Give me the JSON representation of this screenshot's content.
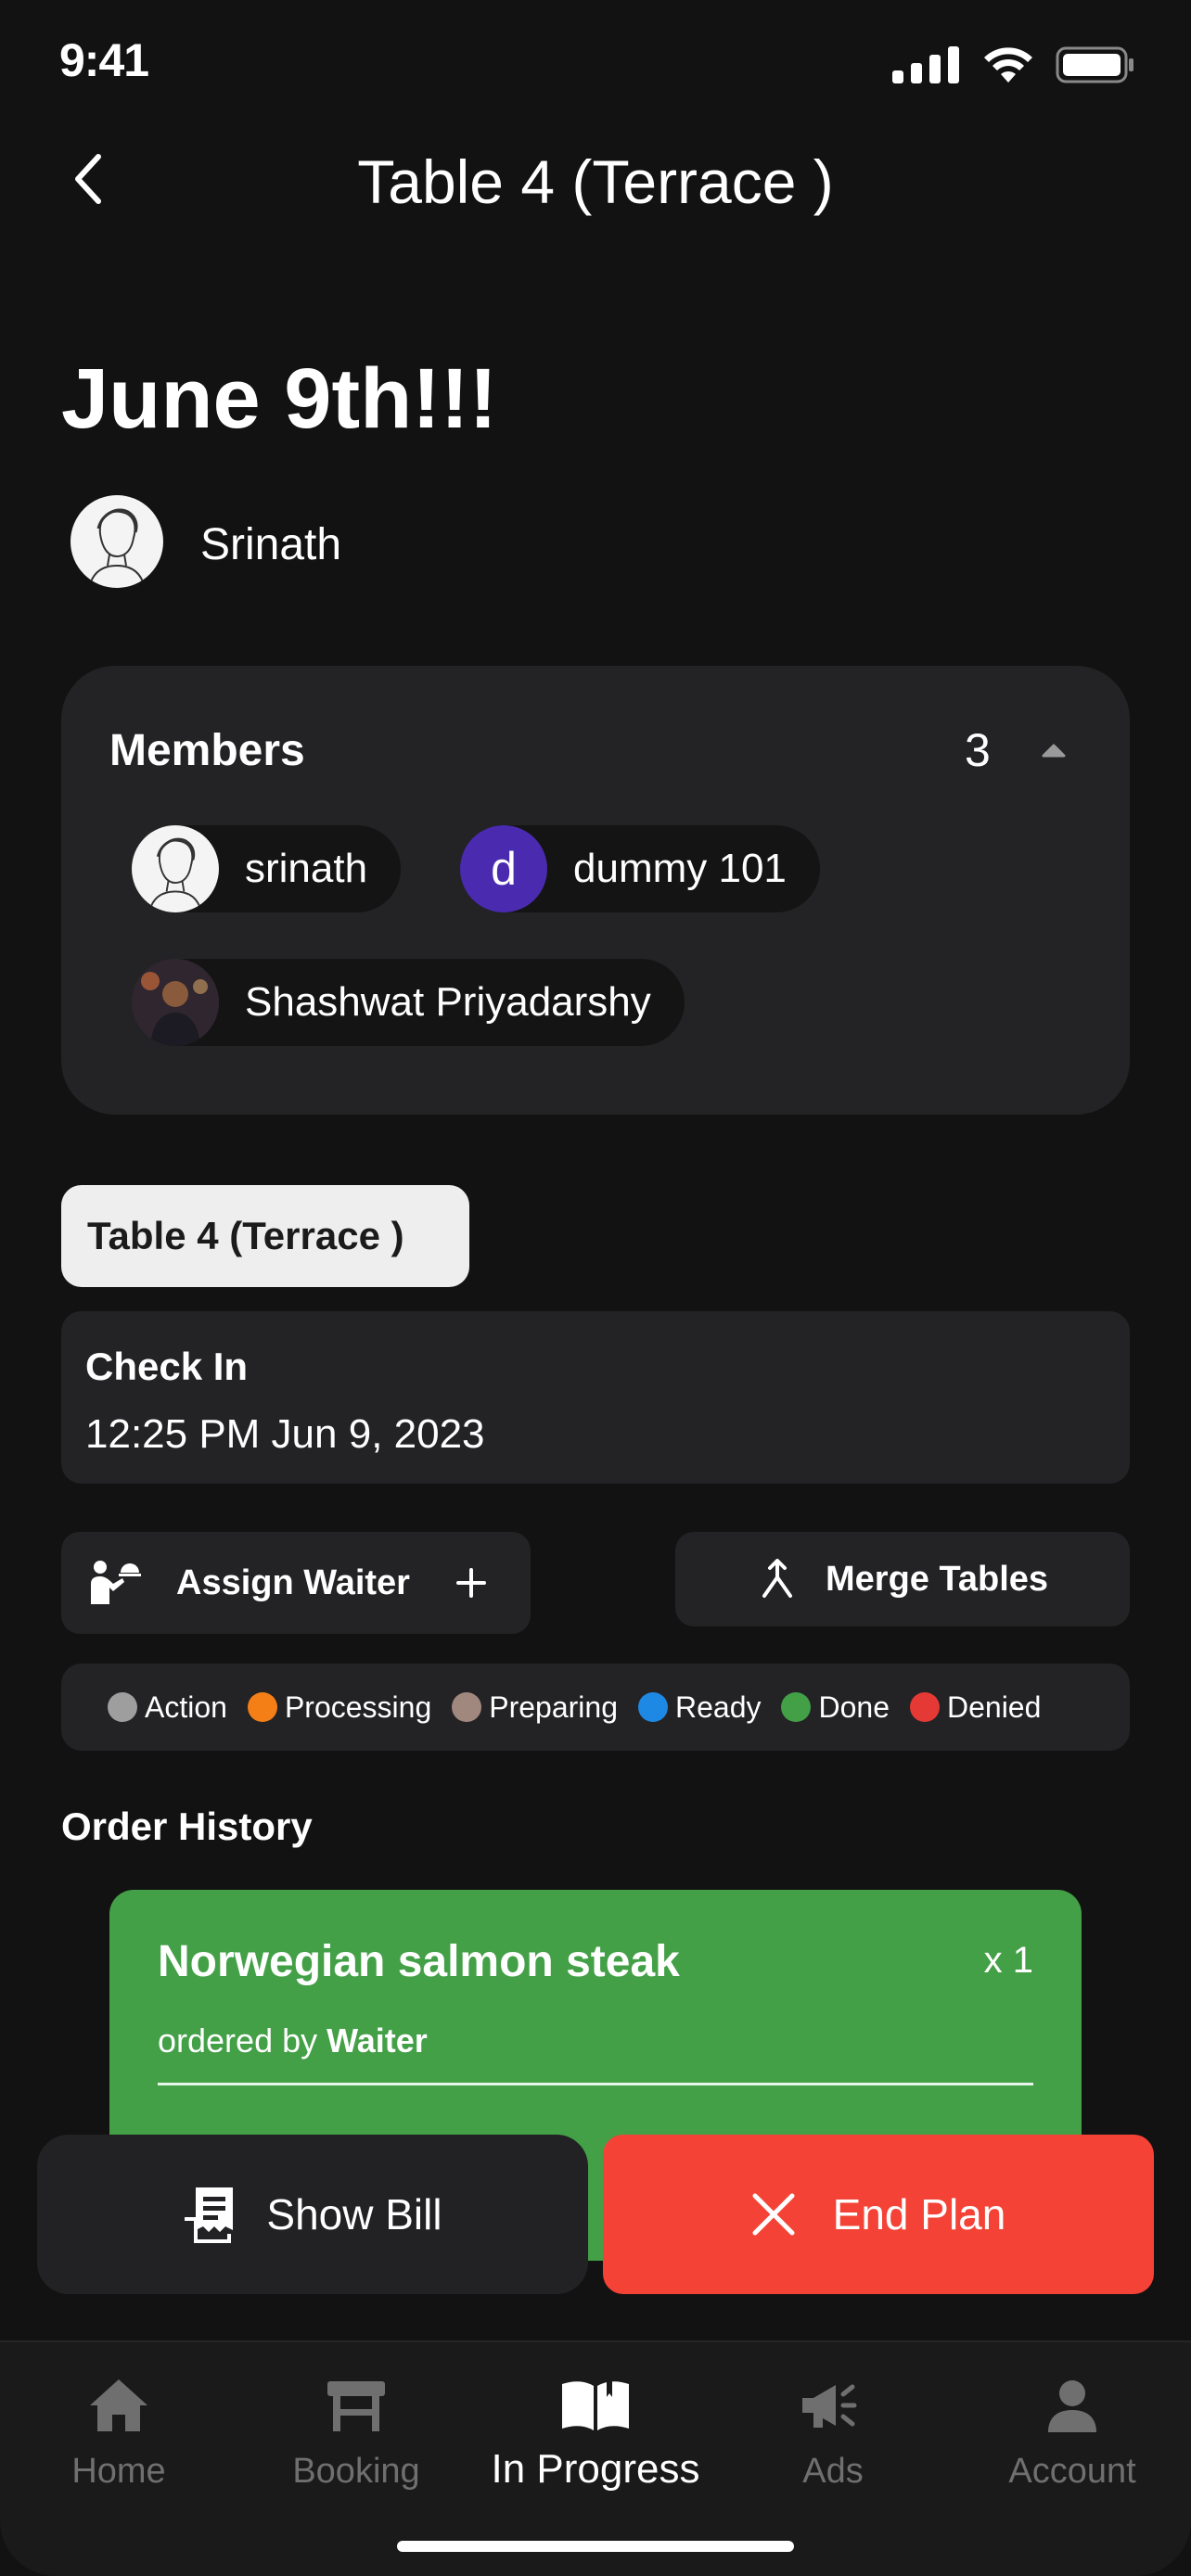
{
  "status_bar": {
    "time": "9:41"
  },
  "header": {
    "title": "Table 4  (Terrace )"
  },
  "plan": {
    "title": "June 9th!!!",
    "owner_name": "Srinath"
  },
  "members": {
    "title": "Members",
    "count": "3",
    "list": [
      {
        "name": "srinath",
        "avatar": "sketch"
      },
      {
        "name": "dummy 101",
        "avatar_letter": "d",
        "avatar_color": "#4a2bb0"
      },
      {
        "name": "Shashwat Priyadarshy",
        "avatar": "photo"
      }
    ]
  },
  "table_pill": {
    "label": "Table 4  (Terrace )"
  },
  "check_in": {
    "label": "Check In",
    "value": "12:25 PM Jun 9, 2023"
  },
  "actions": {
    "assign_waiter": "Assign Waiter",
    "merge_tables": "Merge Tables"
  },
  "legend": [
    {
      "label": "Action",
      "color": "#9e9e9e"
    },
    {
      "label": "Processing",
      "color": "#f57f17"
    },
    {
      "label": "Preparing",
      "color": "#a1887f"
    },
    {
      "label": "Ready",
      "color": "#1e88e5"
    },
    {
      "label": "Done",
      "color": "#43a047"
    },
    {
      "label": "Denied",
      "color": "#e53935"
    }
  ],
  "order_history": {
    "title": "Order History",
    "orders": [
      {
        "name": "Norwegian salmon steak",
        "qty": "x 1",
        "ordered_by_prefix": "ordered by",
        "ordered_by": "Waiter",
        "status_color": "#43a047"
      }
    ]
  },
  "bottom_actions": {
    "show_bill": "Show Bill",
    "end_plan": "End Plan"
  },
  "tabbar": {
    "tabs": [
      {
        "label": "Home",
        "icon": "home-icon"
      },
      {
        "label": "Booking",
        "icon": "table-icon"
      },
      {
        "label": "In Progress",
        "icon": "open-book-icon",
        "active": true
      },
      {
        "label": "Ads",
        "icon": "megaphone-icon"
      },
      {
        "label": "Account",
        "icon": "person-icon"
      }
    ]
  }
}
